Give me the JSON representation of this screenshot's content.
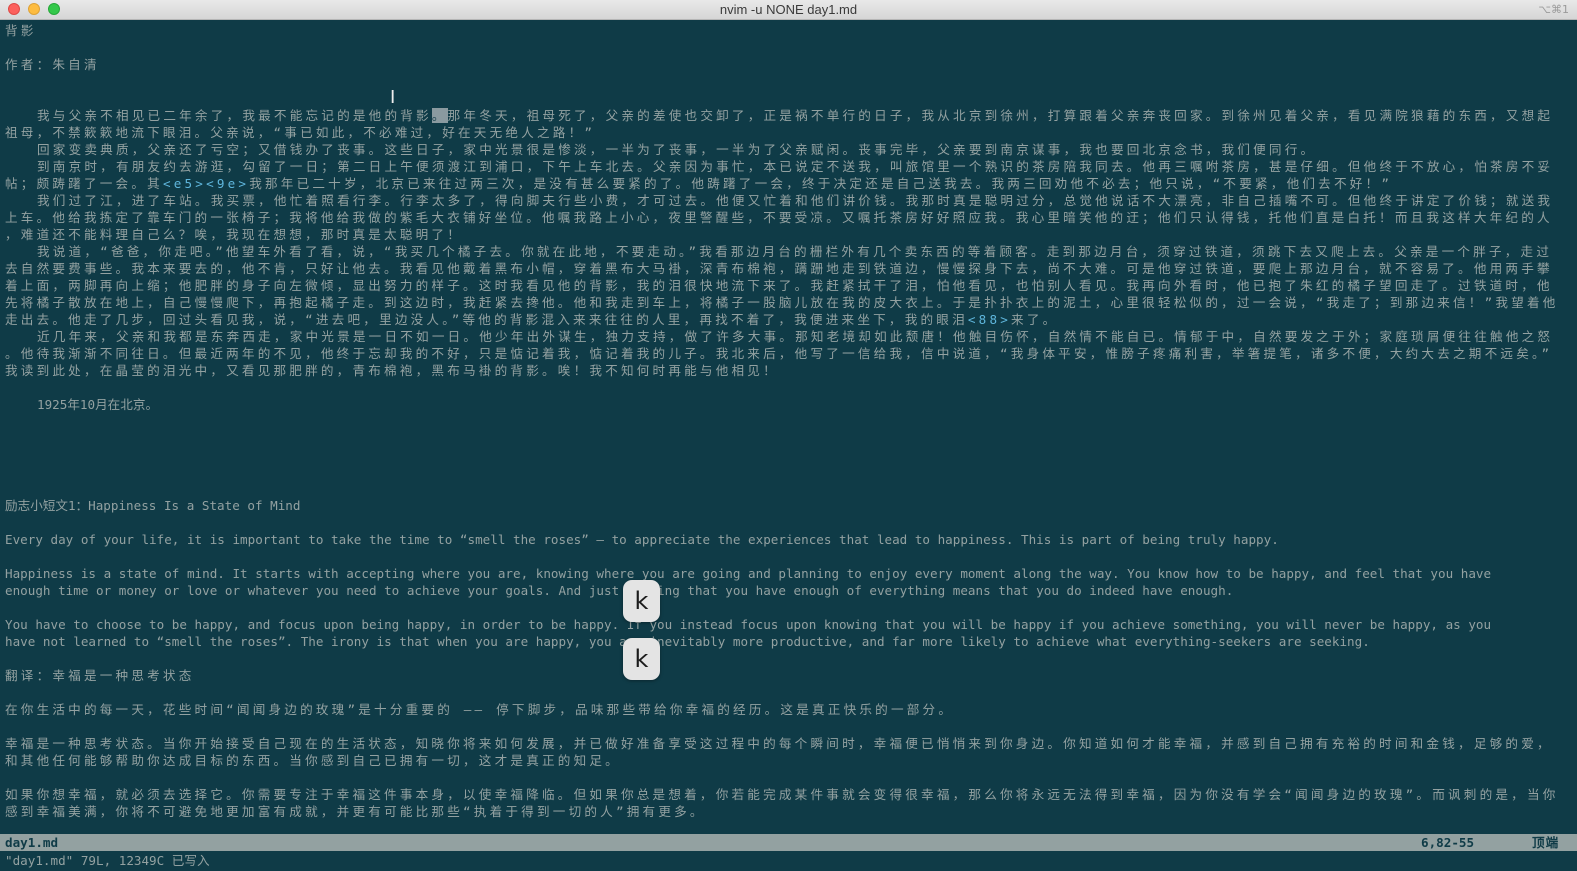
{
  "window": {
    "title": "nvim -u NONE day1.md",
    "shortcut": "⌥⌘1"
  },
  "buffer": {
    "lines": [
      "背影",
      "作者：朱自清",
      "我与父亲不相见已二年余了，我最不能忘记的是他的背影。那年冬天，祖母死了，父亲的差使也交卸了，正是祸不单行的日子，我从北京到徐州，打算跟着父亲奔丧回家。到徐州见着父亲，看见满院狼藉的东西，又想起",
      "祖母，不禁簌簌地流下眼泪。父亲说，“事已如此，不必难过，好在天无绝人之路！”",
      "回家变卖典质，父亲还了亏空；又借钱办了丧事。这些日子，家中光景很是惨淡，一半为了丧事，一半为了父亲赋闲。丧事完毕，父亲要到南京谋事，我也要回北京念书，我们便同行。",
      "到南京时，有朋友约去游逛，勾留了一日；第二日上午便须渡江到浦口，下午上车北去。父亲因为事忙，本已说定不送我，叫旅馆里一个熟识的茶房陪我同去。他再三嘱咐茶房，甚是仔细。但他终于不放心，怕茶房不妥",
      "帖；颇踌躇了一会。其",
      "<e5><9e>",
      "我那年已二十岁，北京已来往过两三次，是没有甚么要紧的了。他踌躇了一会，终于决定还是自己送我去。我两三回劝他不必去；他只说，“不要紧，他们去不好！”",
      "我们过了江，进了车站。我买票，他忙着照看行李。行李太多了，得向脚夫行些小费，才可过去。他便又忙着和他们讲价钱。我那时真是聪明过分，总觉他说话不大漂亮，非自己插嘴不可。但他终于讲定了价钱；就送我",
      "上车。他给我拣定了靠车门的一张椅子；我将他给我做的紫毛大衣铺好坐位。他嘱我路上小心，夜里警醒些，不要受凉。又嘱托茶房好好照应我。我心里暗笑他的迂；他们只认得钱，托他们直是白托！而且我这样大年纪的人",
      "，难道还不能料理自己么？唉，我现在想想，那时真是太聪明了！",
      "我说道，“爸爸，你走吧。”他望车外看了看，说，“我买几个橘子去。你就在此地，不要走动。”我看那边月台的栅栏外有几个卖东西的等着顾客。走到那边月台，须穿过铁道，须跳下去又爬上去。父亲是一个胖子，走过",
      "去自然要费事些。我本来要去的，他不肯，只好让他去。我看见他戴着黑布小帽，穿着黑布大马褂，深青布棉袍，蹒跚地走到铁道边，慢慢探身下去，尚不大难。可是他穿过铁道，要爬上那边月台，就不容易了。他用两手攀",
      "着上面，两脚再向上缩；他肥胖的身子向左微倾，显出努力的样子。这时我看见他的背影，我的泪很快地流下来了。我赶紧拭干了泪，怕他看见，也怕别人看见。我再向外看时，他已抱了朱红的橘子望回走了。过铁道时，他",
      "先将橘子散放在地上，自己慢慢爬下，再抱起橘子走。到这边时，我赶紧去搀他。他和我走到车上，将橘子一股脑儿放在我的皮大衣上。于是扑扑衣上的泥土，心里很轻松似的，过一会说，“我走了；到那边来信！”我望着他",
      "走出去。他走了几步，回过头看见我，说，“进去吧，里边没人。”等他的背影混入来来往往的人里，再找不着了，我便进来坐下，我的眼泪",
      "<88>",
      "来了。",
      "近几年来，父亲和我都是东奔西走，家中光景是一日不如一日。他少年出外谋生，独力支持，做了许多大事。那知老境却如此颓唐！他触目伤怀，自然情不能自已。情郁于中，自然要发之于外；家庭琐屑便往往触他之怒",
      "。他待我渐渐不同往日。但最近两年的不见，他终于忘却我的不好，只是惦记着我，惦记着我的儿子。我北来后，他写了一信给我，信中说道，“我身体平安，惟膀子疼痛利害，举箸提笔，诸多不便，大约大去之期不远矣。”",
      "我读到此处，在晶莹的泪光中，又看见那肥胖的，青布棉袍，黑布马褂的背影。唉！我不知何时再能与他相见！",
      "1925年10月在北京。",
      "励志小短文1：Happiness Is a State of Mind",
      "Every day of your life, it is important to take the time to “smell the roses” — to appreciate the experiences that lead to happiness. This is part of being truly happy.",
      "Happiness is a state of mind. It starts with accepting where you are, knowing where you are going and planning to enjoy every moment along the way. You know how to be happy, and feel that you have",
      " enough time or money or love or whatever you need to achieve your goals. And just feeling that you have enough of everything means that you do indeed have enough.",
      "You have to choose to be happy, and focus upon being happy, in order to be happy. If you instead focus upon knowing that you will be happy if you achieve something, you will never be happy, as you",
      " have not learned to “smell the roses”. The irony is that when you are happy, you are inevitably more productive, and far more likely to achieve what everything-seekers are seeking.",
      "翻译：幸福是一种思考状态",
      "在你生活中的每一天，花些时间“闻闻身边的玫瑰”是十分重要的 —— 停下脚步，品味那些带给你幸福的经历。这是真正快乐的一部分。",
      "幸福是一种思考状态。当你开始接受自己现在的生活状态，知晓你将来如何发展，并已做好准备享受这过程中的每个瞬间时，幸福便已悄悄来到你身边。你知道如何才能幸福，并感到自己拥有充裕的时间和金钱，足够的爱，",
      "和其他任何能够帮助你达成目标的东西。当你感到自己已拥有一切，这才是真正的知足。",
      "如果你想幸福，就必须去选择它。你需要专注于幸福这件事本身，以使幸福降临。但如果你总是想着，你若能完成某件事就会变得很幸福，那么你将永远无法得到幸福，因为你没有学会“闻闻身边的玫瑰”。而讽刺的是，当你",
      "感到幸福美满，你将不可避免地更加富有成就，并更有可能比那些“执着于得到一切的人”拥有更多。"
    ]
  },
  "overlays": {
    "key_1": "k",
    "key_2": "k"
  },
  "statusline": {
    "filename": "day1.md",
    "position": "6,82-55",
    "scroll": "顶端"
  },
  "message": "\"day1.md\" 79L, 12349C 已写入"
}
